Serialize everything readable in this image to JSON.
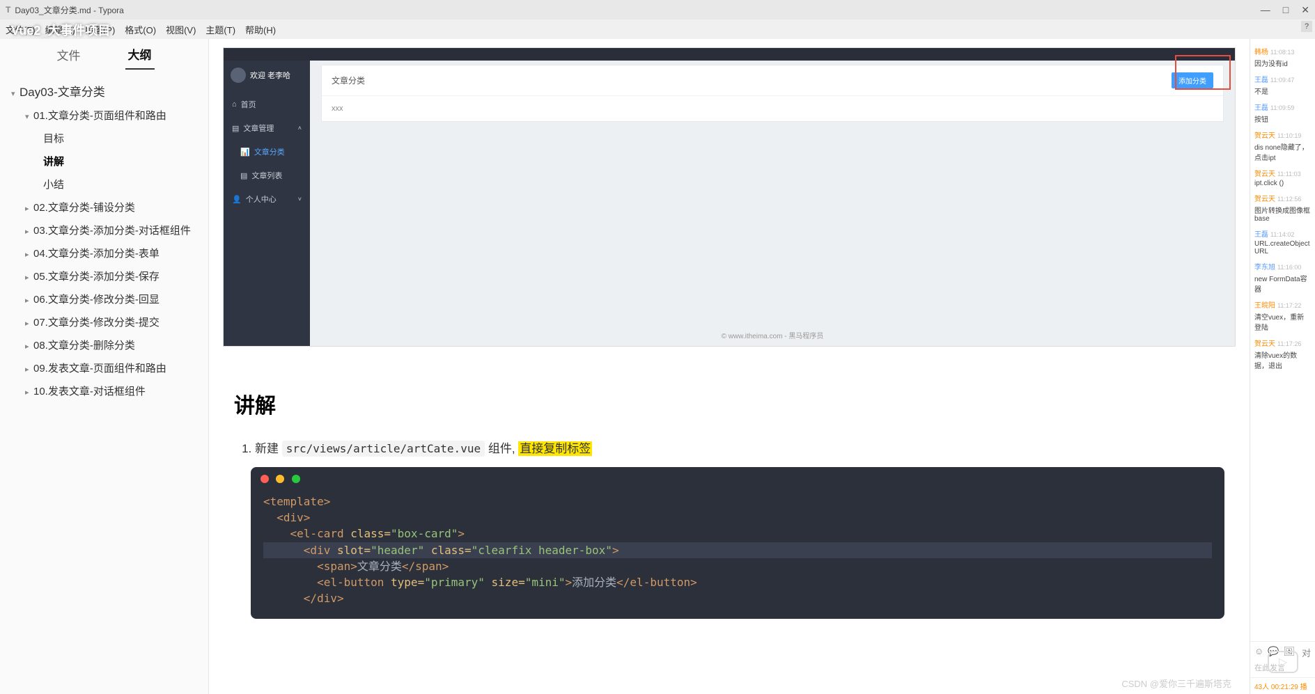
{
  "window": {
    "title": "Day03_文章分类.md - Typora",
    "overlay_title": "Vue2_大事件项目"
  },
  "menu": {
    "items": [
      "文件(F)",
      "编辑(E)",
      "段落(P)",
      "格式(O)",
      "视图(V)",
      "主题(T)",
      "帮助(H)"
    ]
  },
  "sidebar_tabs": {
    "file": "文件",
    "outline": "大纲"
  },
  "outline": {
    "root": "Day03-文章分类",
    "section1": "01.文章分类-页面组件和路由",
    "s1_1": "目标",
    "s1_2": "讲解",
    "s1_3": "小结",
    "section2": "02.文章分类-铺设分类",
    "section3": "03.文章分类-添加分类-对话框组件",
    "section4": "04.文章分类-添加分类-表单",
    "section5": "05.文章分类-添加分类-保存",
    "section6": "06.文章分类-修改分类-回显",
    "section7": "07.文章分类-修改分类-提交",
    "section8": "08.文章分类-删除分类",
    "section9": "09.发表文章-页面组件和路由",
    "section10": "10.发表文章-对话框组件"
  },
  "app_shot": {
    "welcome": "欢迎 老李哈",
    "nav_home": "首页",
    "nav_article_mgmt": "文章管理",
    "nav_article_cate": "文章分类",
    "nav_article_list": "文章列表",
    "nav_user": "个人中心",
    "card_title": "文章分类",
    "add_btn": "添加分类",
    "body_text": "xxx",
    "footer": "© www.itheima.com - 黑马程序员"
  },
  "article": {
    "heading": "讲解",
    "step1_prefix": "新建 ",
    "step1_code": "src/views/article/artCate.vue",
    "step1_mid": " 组件, ",
    "step1_highlight": "直接复制标签"
  },
  "code": {
    "l1_open": "<template>",
    "l2": "<div>",
    "l3_a": "<el-card ",
    "l3_b": "class=",
    "l3_c": "\"box-card\"",
    "l3_d": ">",
    "l4_a": "<div ",
    "l4_b": "slot=",
    "l4_c": "\"header\"",
    "l4_d": " class=",
    "l4_e": "\"clearfix header-box\"",
    "l4_f": ">",
    "l5_a": "<span>",
    "l5_b": "文章分类",
    "l5_c": "</span>",
    "l6_a": "<el-button ",
    "l6_b": "type=",
    "l6_c": "\"primary\"",
    "l6_d": " size=",
    "l6_e": "\"mini\"",
    "l6_f": ">",
    "l6_g": "添加分类",
    "l6_h": "</el-button>",
    "l7": "</div>"
  },
  "chat": {
    "messages": [
      {
        "name": "韩杨",
        "time": "11:08:13",
        "text": "因为没有id",
        "cls": ""
      },
      {
        "name": "王磊",
        "time": "11:09:47",
        "text": "不是",
        "cls": "blue"
      },
      {
        "name": "王磊",
        "time": "11:09:59",
        "text": "按钮",
        "cls": "blue"
      },
      {
        "name": "贺云天",
        "time": "11:10:19",
        "text": "dis  none隐藏了，点击ipt",
        "cls": ""
      },
      {
        "name": "贺云天",
        "time": "11:11:03",
        "text": "ipt.click ()",
        "cls": ""
      },
      {
        "name": "贺云天",
        "time": "11:12:56",
        "text": "图片转换成图像框base",
        "cls": ""
      },
      {
        "name": "王磊",
        "time": "11:14:02",
        "text": "URL.createObjectURL",
        "cls": "blue"
      },
      {
        "name": "李东旭",
        "time": "11:16:00",
        "text": "new  FormData容器",
        "cls": "blue"
      },
      {
        "name": "王皖阳",
        "time": "11:17:22",
        "text": "清空vuex，重新登陆",
        "cls": ""
      },
      {
        "name": "贺云天",
        "time": "11:17:26",
        "text": "清除vuex的数据，退出",
        "cls": ""
      }
    ],
    "input_placeholder": "在此发言",
    "footer": "43人   00:21:29  播"
  },
  "watermark": "CSDN @爱你三千遍斯塔克"
}
